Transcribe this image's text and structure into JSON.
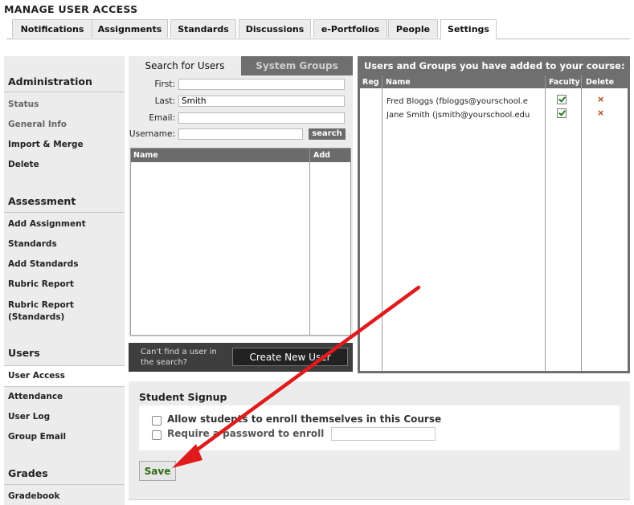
{
  "page": {
    "title": "MANAGE USER ACCESS"
  },
  "tabs": [
    {
      "label": "Notifications"
    },
    {
      "label": "Assignments"
    },
    {
      "label": "Standards"
    },
    {
      "label": "Discussions"
    },
    {
      "label": "e-Portfolios"
    },
    {
      "label": "People"
    },
    {
      "label": "Settings",
      "active": true
    }
  ],
  "sidebar": {
    "sections": [
      {
        "heading": "Administration",
        "items": [
          "Status",
          "General Info",
          "Import & Merge",
          "Delete"
        ]
      },
      {
        "heading": "Assessment",
        "items": [
          "Add Assignment",
          "Standards",
          "Add Standards",
          "Rubric Report",
          "Rubric Report (Standards)"
        ]
      },
      {
        "heading": "Users",
        "items": [
          "User Access",
          "Attendance",
          "User Log",
          "Group Email"
        ]
      },
      {
        "heading": "Grades",
        "items": [
          "Gradebook"
        ]
      }
    ],
    "active_item": "User Access"
  },
  "search": {
    "tab_active": "Search for Users",
    "tab_inactive": "System Groups",
    "first_label": "First:",
    "first_value": "",
    "last_label": "Last:",
    "last_value": "Smith",
    "email_label": "Email:",
    "email_value": "",
    "username_label": "Username:",
    "username_value": "",
    "button": "search",
    "results_columns": [
      "Name",
      "Add"
    ]
  },
  "create_user": {
    "prompt": "Can't find a user in the search?",
    "button": "Create New User"
  },
  "course_users": {
    "title": "Users and Groups you have added to your course:",
    "columns": [
      "Reg",
      "Name",
      "Faculty",
      "Delete"
    ],
    "rows": [
      {
        "name": "Fred Bloggs (fbloggs@yourschool.e",
        "faculty": true
      },
      {
        "name": "Jane Smith (jsmith@yourschool.edu",
        "faculty": true
      }
    ],
    "delete_glyph": "×"
  },
  "signup": {
    "title": "Student Signup",
    "allow_label": "Allow students to enroll themselves in this Course",
    "allow_checked": false,
    "require_pw_label": "Require a password to enroll",
    "require_pw_checked": false,
    "password_value": "",
    "save_label": "Save"
  },
  "colors": {
    "panel_dark": "#6f6f6f",
    "panel_light": "#ececec",
    "save_text": "#2f6b12",
    "annotation_arrow": "#e01b1b"
  }
}
